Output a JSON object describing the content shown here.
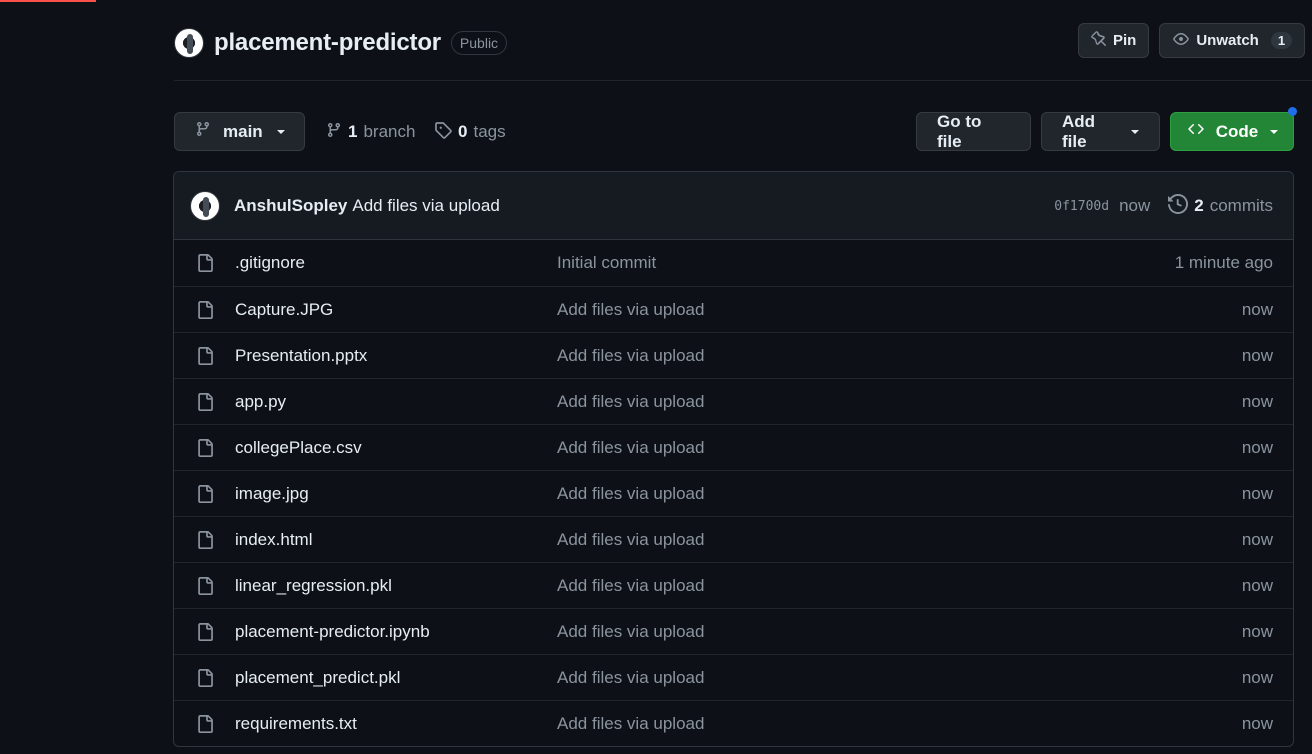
{
  "repo": {
    "name": "placement-predictor",
    "visibility": "Public"
  },
  "header_actions": {
    "pin_label": "Pin",
    "unwatch_label": "Unwatch",
    "watch_count": "1"
  },
  "toolbar": {
    "branch_name": "main",
    "branch_count": "1",
    "branch_label": "branch",
    "tag_count": "0",
    "tag_label": "tags",
    "go_to_file_label": "Go to file",
    "add_file_label": "Add file",
    "code_label": "Code"
  },
  "latest_commit": {
    "author": "AnshulSopley",
    "message": "Add files via upload",
    "sha": "0f1700d",
    "time": "now",
    "commit_count": "2",
    "commits_label": "commits"
  },
  "files": [
    {
      "name": ".gitignore",
      "commit": "Initial commit",
      "time": "1 minute ago"
    },
    {
      "name": "Capture.JPG",
      "commit": "Add files via upload",
      "time": "now"
    },
    {
      "name": "Presentation.pptx",
      "commit": "Add files via upload",
      "time": "now"
    },
    {
      "name": "app.py",
      "commit": "Add files via upload",
      "time": "now"
    },
    {
      "name": "collegePlace.csv",
      "commit": "Add files via upload",
      "time": "now"
    },
    {
      "name": "image.jpg",
      "commit": "Add files via upload",
      "time": "now"
    },
    {
      "name": "index.html",
      "commit": "Add files via upload",
      "time": "now"
    },
    {
      "name": "linear_regression.pkl",
      "commit": "Add files via upload",
      "time": "now"
    },
    {
      "name": "placement-predictor.ipynb",
      "commit": "Add files via upload",
      "time": "now"
    },
    {
      "name": "placement_predict.pkl",
      "commit": "Add files via upload",
      "time": "now"
    },
    {
      "name": "requirements.txt",
      "commit": "Add files via upload",
      "time": "now"
    }
  ],
  "colors": {
    "background": "#0d1117",
    "code_button": "#238636",
    "muted_text": "#8b949e"
  }
}
